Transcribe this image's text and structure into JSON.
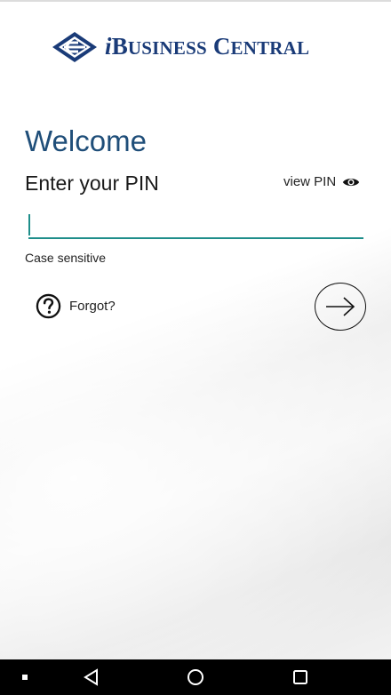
{
  "brand": {
    "logo_prefix": "i",
    "logo_b": "B",
    "logo_usiness": "USINESS",
    "logo_c": "C",
    "logo_entral": "ENTRAL",
    "logo_color": "#1a3b78"
  },
  "login": {
    "welcome": "Welcome",
    "pin_label": "Enter your PIN",
    "view_pin": "view PIN",
    "pin_value": "",
    "hint": "Case sensitive",
    "forgot": "Forgot?",
    "accent_color": "#1e8e8a",
    "title_color": "#1f4e79"
  },
  "icons": {
    "view_pin": "eye-icon",
    "forgot": "question-circle-icon",
    "submit": "arrow-right-icon",
    "nav_dot": "dot-icon",
    "nav_back": "triangle-back-icon",
    "nav_home": "circle-home-icon",
    "nav_recents": "square-recents-icon"
  }
}
